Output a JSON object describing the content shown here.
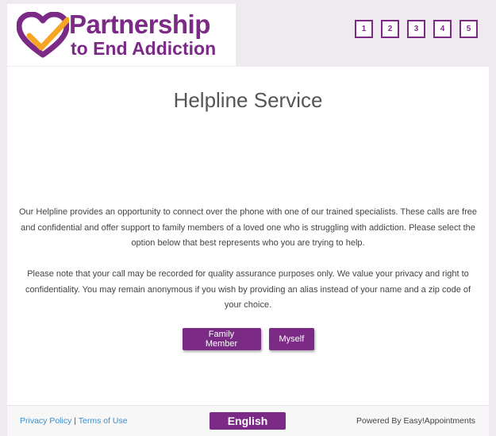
{
  "brand": {
    "line1": "Partnership",
    "line2": "to End Addiction",
    "purple": "#7b2a86",
    "orange": "#f5a623"
  },
  "steps": [
    "1",
    "2",
    "3",
    "4",
    "5"
  ],
  "main": {
    "title": "Helpline Service",
    "paragraph1": "Our Helpline provides an opportunity to connect over the phone with one of our trained specialists. These calls are free and confidential and offer support to family members of a loved one who is struggling with addiction. Please select the option below that best represents who you are trying to help.",
    "paragraph2": "Please note that your call may be recorded for quality assurance purposes only. We value your privacy and right to confidentiality. You may remain anonymous if you wish by providing an alias instead of your name and a zip code of your choice.",
    "buttons": {
      "family": "Family Member",
      "myself": "Myself"
    }
  },
  "footer": {
    "privacy": "Privacy Policy",
    "separator": "|",
    "terms": "Terms of Use",
    "language": "English",
    "powered": "Powered By Easy!Appointments"
  }
}
